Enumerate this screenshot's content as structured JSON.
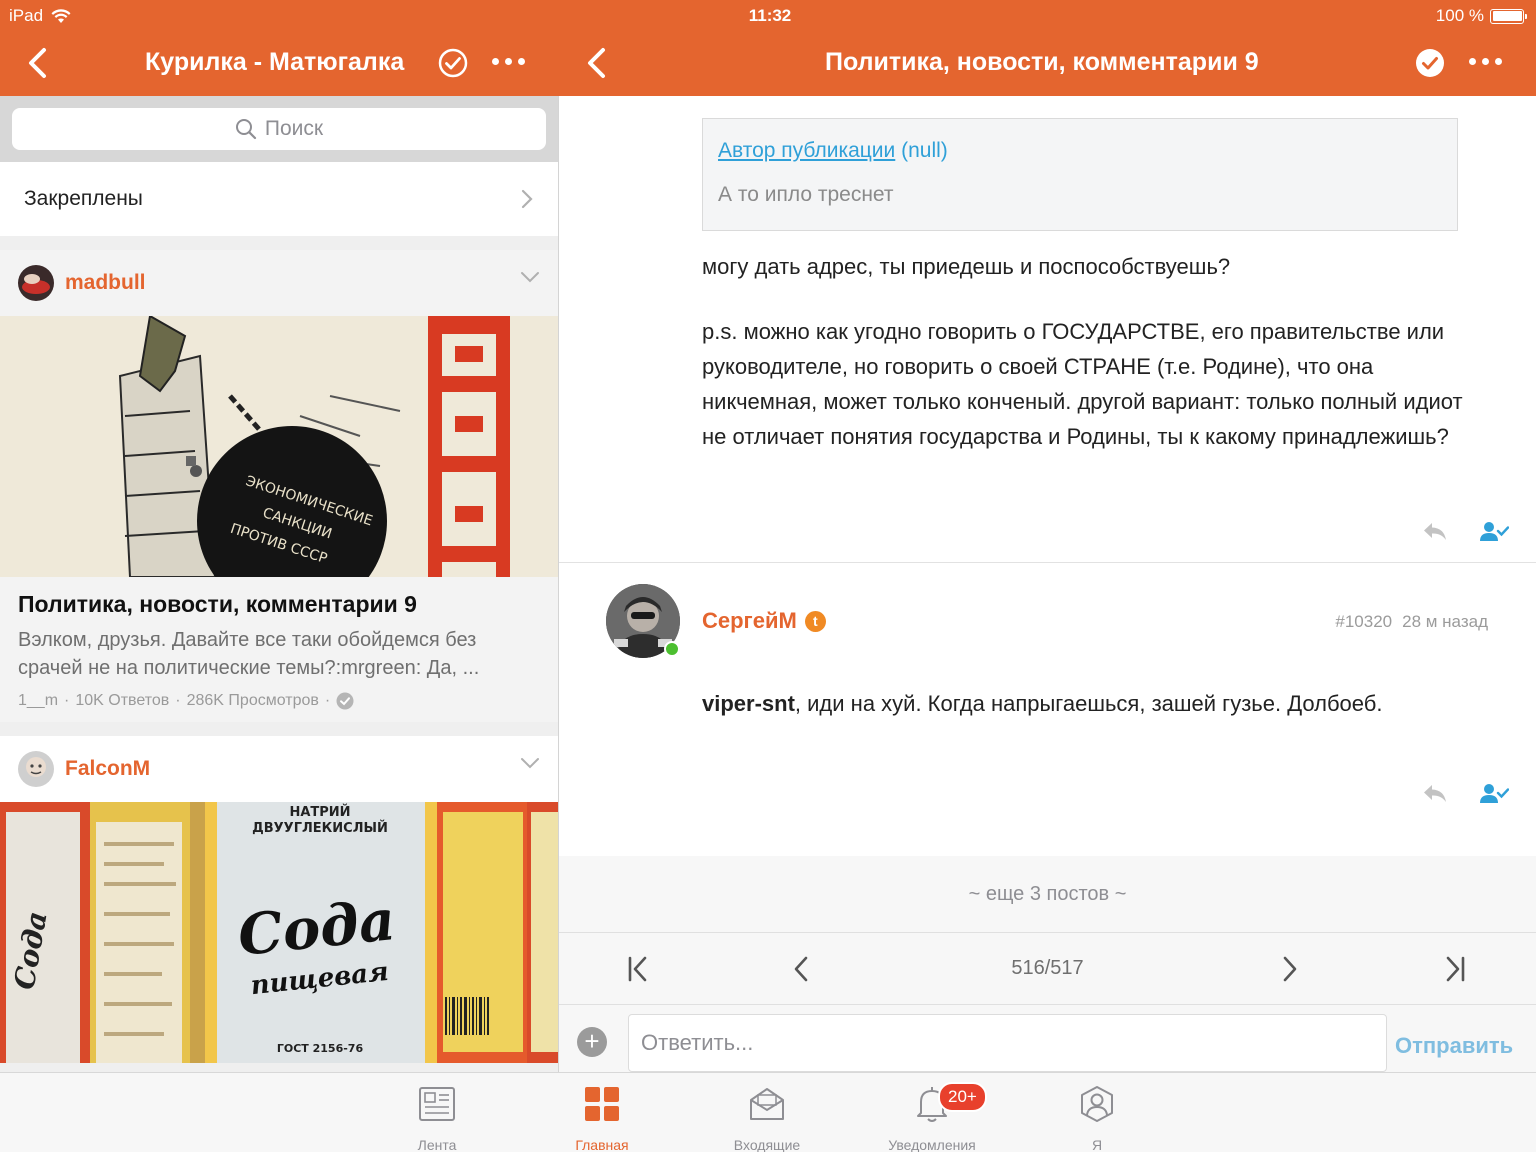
{
  "status": {
    "device": "iPad",
    "time": "11:32",
    "battery": "100 %"
  },
  "left_nav": {
    "title": "Курилка - Матюгалка"
  },
  "right_nav": {
    "title": "Политика, новости, комментарии 9"
  },
  "search": {
    "placeholder": "Поиск"
  },
  "pinned": {
    "label": "Закреплены"
  },
  "cards": [
    {
      "author": "madbull",
      "image_text": [
        "ЭКОНОМИЧЕСКИЕ",
        "САНКЦИИ",
        "ПРОТИВ СССР"
      ],
      "title": "Политика, новости, комментарии 9",
      "excerpt": "Вэлком, друзья. Давайте все таки обойдемся без срачей не на политические темы?:mrgreen: Да, ...",
      "meta_user": "1__m",
      "meta_replies": "10K Ответов",
      "meta_views": "286K Просмотров"
    },
    {
      "author": "FalconM",
      "image_text": [
        "НАТРИЙ",
        "ДВУУГЛЕКИСЛЫЙ",
        "Сода",
        "пищевая",
        "ГОСТ 2156-76",
        "Сода"
      ]
    }
  ],
  "thread": {
    "quote_link": "Автор публикации",
    "quote_null": " (null)",
    "quote_text": "А то ипло треснет",
    "post1_p1": "могу дать адрес, ты приедешь и поспособствуешь?",
    "post1_p2": "p.s. можно как угодно говорить о ГОСУДАРСТВЕ, его правительстве или руководителе, но говорить о своей СТРАНЕ (т.е. Родине), что она никчемная, может только конченый. другой вариант: только полный идиот не отличает понятия государства и Родины, ты к какому принадлежишь?",
    "post2_author": "СергейМ",
    "post2_badge": "t",
    "post2_number": "#10320",
    "post2_time": "28 м назад",
    "post2_mention": "viper-snt",
    "post2_text": ", иди на хуй. Когда напрыгаешься, зашей гузье. Долбоеб.",
    "more_posts": "~ еще 3 постов ~",
    "page": "516/517",
    "reply_placeholder": "Ответить...",
    "send_label": "Отправить"
  },
  "tabs": [
    {
      "label": "Лента",
      "icon": "feed-icon"
    },
    {
      "label": "Главная",
      "icon": "grid-icon",
      "active": true
    },
    {
      "label": "Входящие",
      "icon": "inbox-icon"
    },
    {
      "label": "Уведомления",
      "icon": "bell-icon",
      "badge": "20+"
    },
    {
      "label": "Я",
      "icon": "profile-icon"
    }
  ],
  "colors": {
    "accent": "#e4652f",
    "link": "#2fa0d8",
    "online": "#4cbf30",
    "badge": "#e8402c"
  }
}
